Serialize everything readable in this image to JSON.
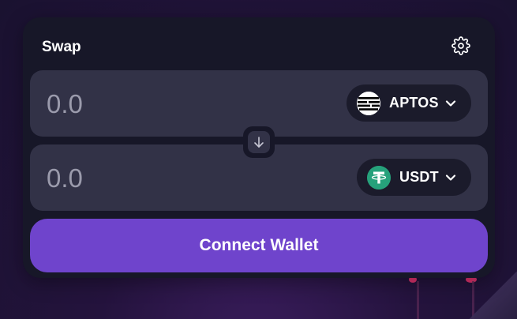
{
  "swap": {
    "title": "Swap",
    "settings_icon": "gear-icon",
    "from": {
      "amount_placeholder": "0.0",
      "token": "APTOS",
      "token_icon": "aptos-logo-icon"
    },
    "to": {
      "amount_placeholder": "0.0",
      "token": "USDT",
      "token_icon": "tether-logo-icon"
    },
    "switch_icon": "arrow-down-icon",
    "connect_label": "Connect Wallet"
  },
  "colors": {
    "card_bg": "#171728",
    "panel_bg": "#323247",
    "token_pill_bg": "#1b1b2b",
    "primary_button": "#6f44cc",
    "tether_green": "#26a17b",
    "placeholder_text": "#9b9bac"
  }
}
